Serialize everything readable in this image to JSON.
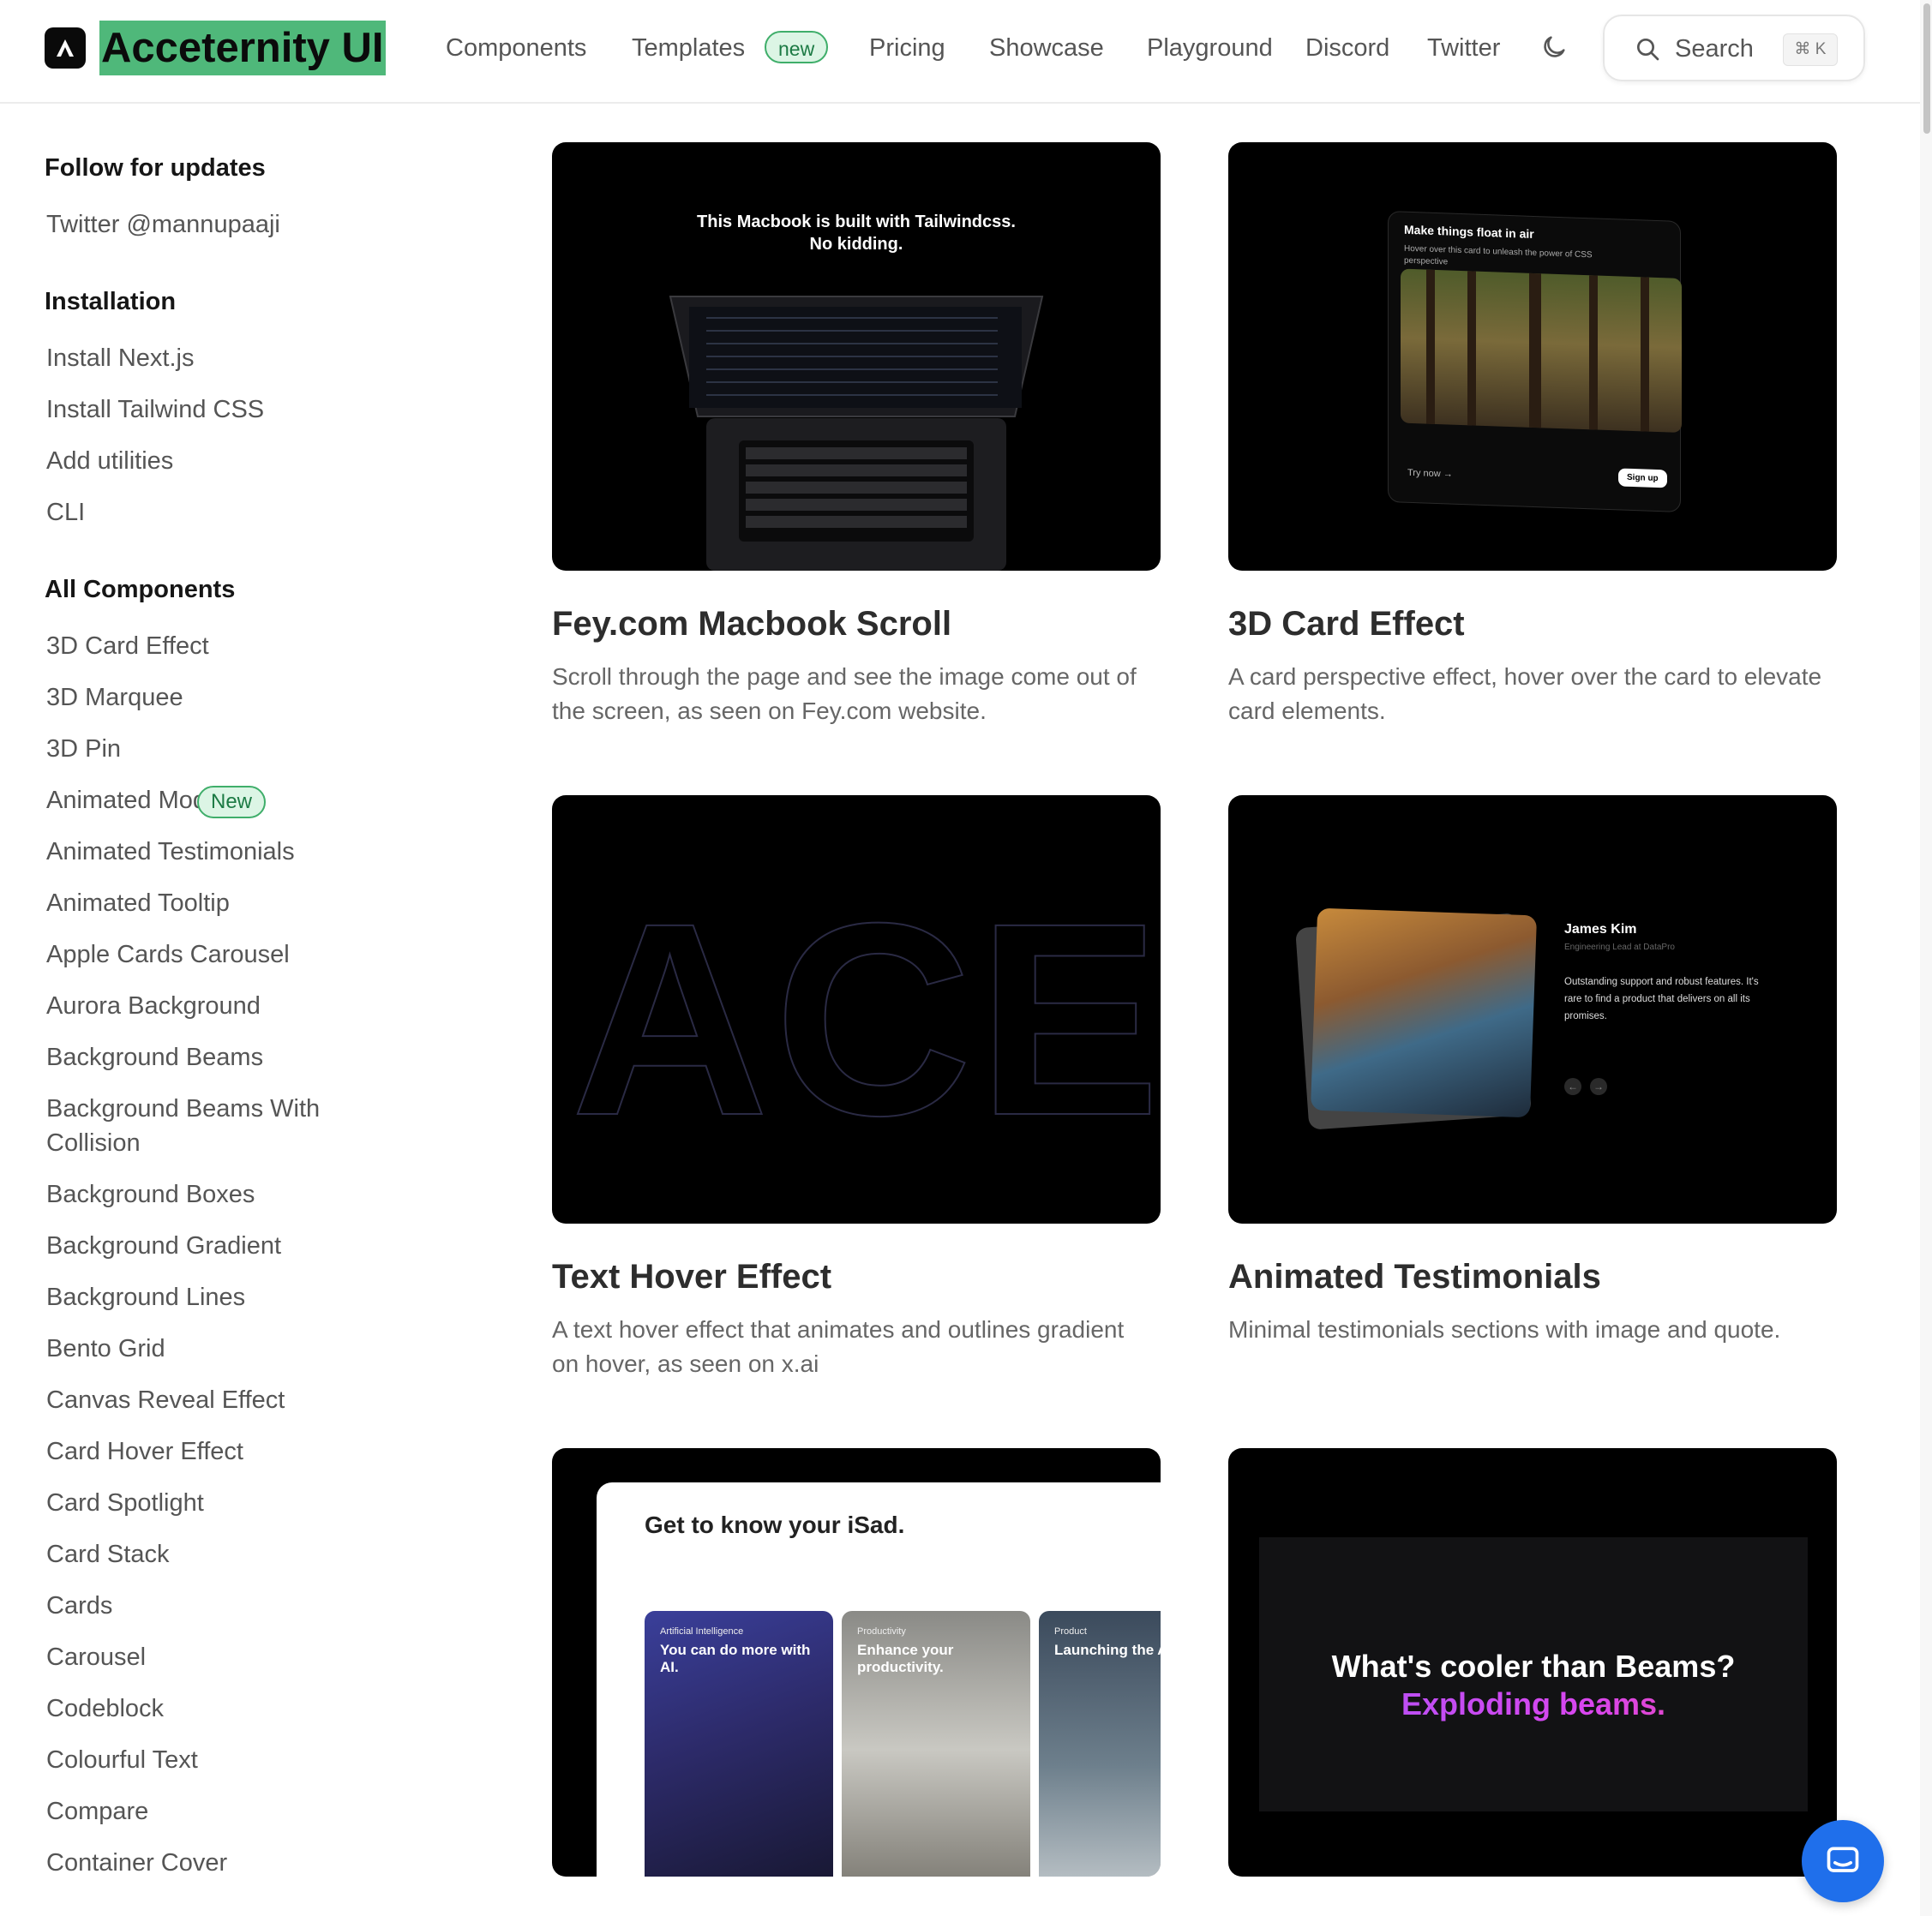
{
  "header": {
    "brand": "Acceternity UI",
    "nav": [
      "Components",
      "Templates",
      "Pricing",
      "Showcase",
      "Playground",
      "Discord",
      "Twitter"
    ],
    "templates_badge": "new",
    "search_label": "Search",
    "search_shortcut": "⌘ K",
    "icons": {
      "logo": "aceternity-logo-icon",
      "theme": "moon-icon",
      "search": "search-icon"
    }
  },
  "sidebar": {
    "follow_heading": "Follow for updates",
    "follow_link": "Twitter @mannupaaji",
    "install_heading": "Installation",
    "install_items": [
      "Install Next.js",
      "Install Tailwind CSS",
      "Add utilities",
      "CLI"
    ],
    "components_heading": "All Components",
    "components": [
      "3D Card Effect",
      "3D Marquee",
      "3D Pin",
      "Animated Modal",
      "Animated Testimonials",
      "Animated Tooltip",
      "Apple Cards Carousel",
      "Aurora Background",
      "Background Beams",
      "Background Beams With Collision",
      "Background Boxes",
      "Background Gradient",
      "Background Lines",
      "Bento Grid",
      "Canvas Reveal Effect",
      "Card Hover Effect",
      "Card Spotlight",
      "Card Stack",
      "Cards",
      "Carousel",
      "Codeblock",
      "Colourful Text",
      "Compare",
      "Container Cover"
    ],
    "marquee_badge": "New"
  },
  "cards": [
    {
      "title": "Fey.com Macbook Scroll",
      "desc": "Scroll through the page and see the image come out of the screen, as seen on Fey.com website.",
      "preview": {
        "headline_1": "This Macbook is built with Tailwindcss.",
        "headline_2": "No kidding."
      }
    },
    {
      "title": "3D Card Effect",
      "desc": "A card perspective effect, hover over the card to elevate card elements.",
      "preview": {
        "title": "Make things float in air",
        "subtitle": "Hover over this card to unleash the power of CSS perspective",
        "try": "Try now →",
        "signup": "Sign up"
      }
    },
    {
      "title": "Text Hover Effect",
      "desc": "A text hover effect that animates and outlines gradient on hover, as seen on x.ai",
      "preview": {
        "word": "ACE"
      }
    },
    {
      "title": "Animated Testimonials",
      "desc": "Minimal testimonials sections with image and quote.",
      "preview": {
        "name": "James Kim",
        "role": "Engineering Lead at DataPro",
        "quote": "Outstanding support and robust features. It's rare to find a product that delivers on all its promises."
      }
    },
    {
      "title": "",
      "desc": "",
      "preview": {
        "title": "Get to know your iSad.",
        "cards": [
          {
            "category": "Artificial Intelligence",
            "headline": "You can do more with AI."
          },
          {
            "category": "Productivity",
            "headline": "Enhance your productivity."
          },
          {
            "category": "Product",
            "headline": "Launching the Apple Vision Pr"
          }
        ]
      }
    },
    {
      "title": "",
      "desc": "",
      "preview": {
        "line_1": "What's cooler than Beams?",
        "line_2": "Exploding beams."
      }
    }
  ],
  "chat_icon": "chat-bubble-icon",
  "colors": {
    "brand_highlight": "#4fb87a",
    "badge_bg": "#dcf5e5",
    "badge_text": "#1c7a44",
    "chat_button": "#1f6feb",
    "gradient_purple": "#a855f7"
  }
}
